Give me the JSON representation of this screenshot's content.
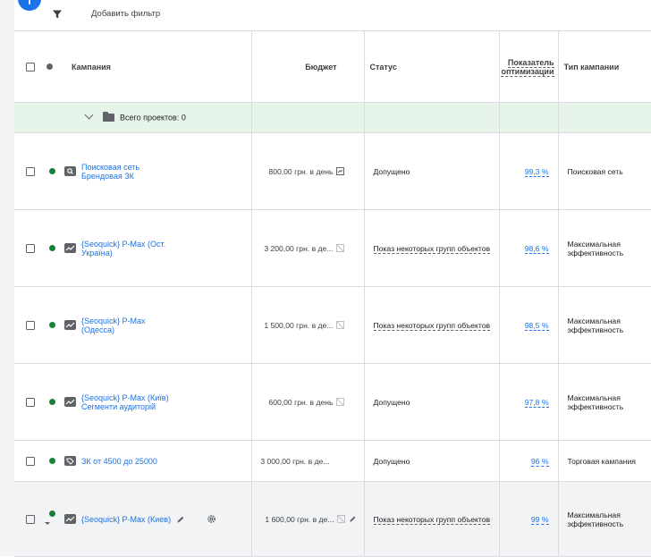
{
  "toolbar": {
    "add_filter": "Добавить фильтр"
  },
  "table": {
    "headers": {
      "campaign": "Кампания",
      "budget": "Бюджет",
      "status": "Статус",
      "opt_line1": "Показатель",
      "opt_line2": "оптимизации",
      "type": "Тип кампании"
    },
    "group": {
      "label": "Всего проектов: 0"
    },
    "rows": [
      {
        "name": "Поисковая сеть Брендовая ЗК",
        "budget": "800,00 грн. в день",
        "status": "Допущено",
        "opt": "99,3 %",
        "type": "Поисковая сеть"
      },
      {
        "name": "{Seoquick} P-Max (Ост. Україна)",
        "budget": "3 200,00 грн. в де...",
        "status": "Показ некоторых групп объектов",
        "opt": "98,6 %",
        "type": "Максимальная эффективность"
      },
      {
        "name": "{Seoquick} P-Max (Одесса)",
        "budget": "1 500,00 грн. в де...",
        "status": "Показ некоторых групп объектов",
        "opt": "98,5 %",
        "type": "Максимальная эффективность"
      },
      {
        "name": "{Seoquick} P-Max (Київ) Сегменти аудиторій",
        "budget": "600,00 грн. в день",
        "status": "Допущено",
        "opt": "97,8 %",
        "type": "Максимальная эффективность"
      },
      {
        "name": "ЗК от 4500 до 25000",
        "budget": "3 000,00 грн. в де...",
        "status": "Допущено",
        "opt": "96 %",
        "type": "Торговая кампания"
      },
      {
        "name": "{Seoquick} P-Max (Киев)",
        "budget": "1 600,00 грн. в де...",
        "status": "Показ некоторых групп объектов",
        "opt": "99 %",
        "type": "Максимальная эффективность"
      }
    ]
  },
  "colors": {
    "accent": "#1a73e8",
    "enabled": "#188038",
    "group_bg": "#e6f4ea"
  }
}
